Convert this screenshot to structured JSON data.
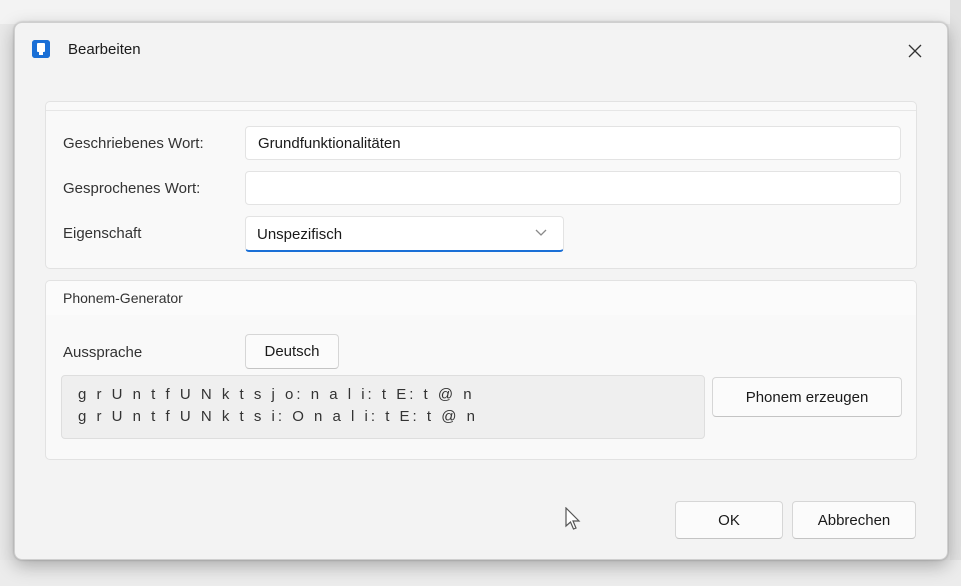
{
  "dialog": {
    "title": "Bearbeiten",
    "icon": "app-book-icon",
    "close_icon": "close-icon"
  },
  "form": {
    "written_word_label": "Geschriebenes Wort:",
    "written_word_value": "Grundfunktionalitäten",
    "spoken_word_label": "Gesprochenes Wort:",
    "spoken_word_value": "",
    "property_label": "Eigenschaft",
    "property_value": "Unspezifisch",
    "property_icon": "chevron-down-icon"
  },
  "phoneme_generator": {
    "header": "Phonem-Generator",
    "pronunciation_label": "Aussprache",
    "language_button": "Deutsch",
    "phonemes": [
      "g r U n t f U N k t s j o: n a l i: t E: t @ n",
      "g r U n t f U N k t s i: O n a l i: t E: t @ n"
    ],
    "generate_button": "Phonem erzeugen"
  },
  "footer": {
    "ok_button": "OK",
    "cancel_button": "Abbrechen"
  },
  "colors": {
    "accent": "#1a6fd6",
    "dialog_bg": "#f3f3f3",
    "panel_bg": "#f9f9f9"
  }
}
